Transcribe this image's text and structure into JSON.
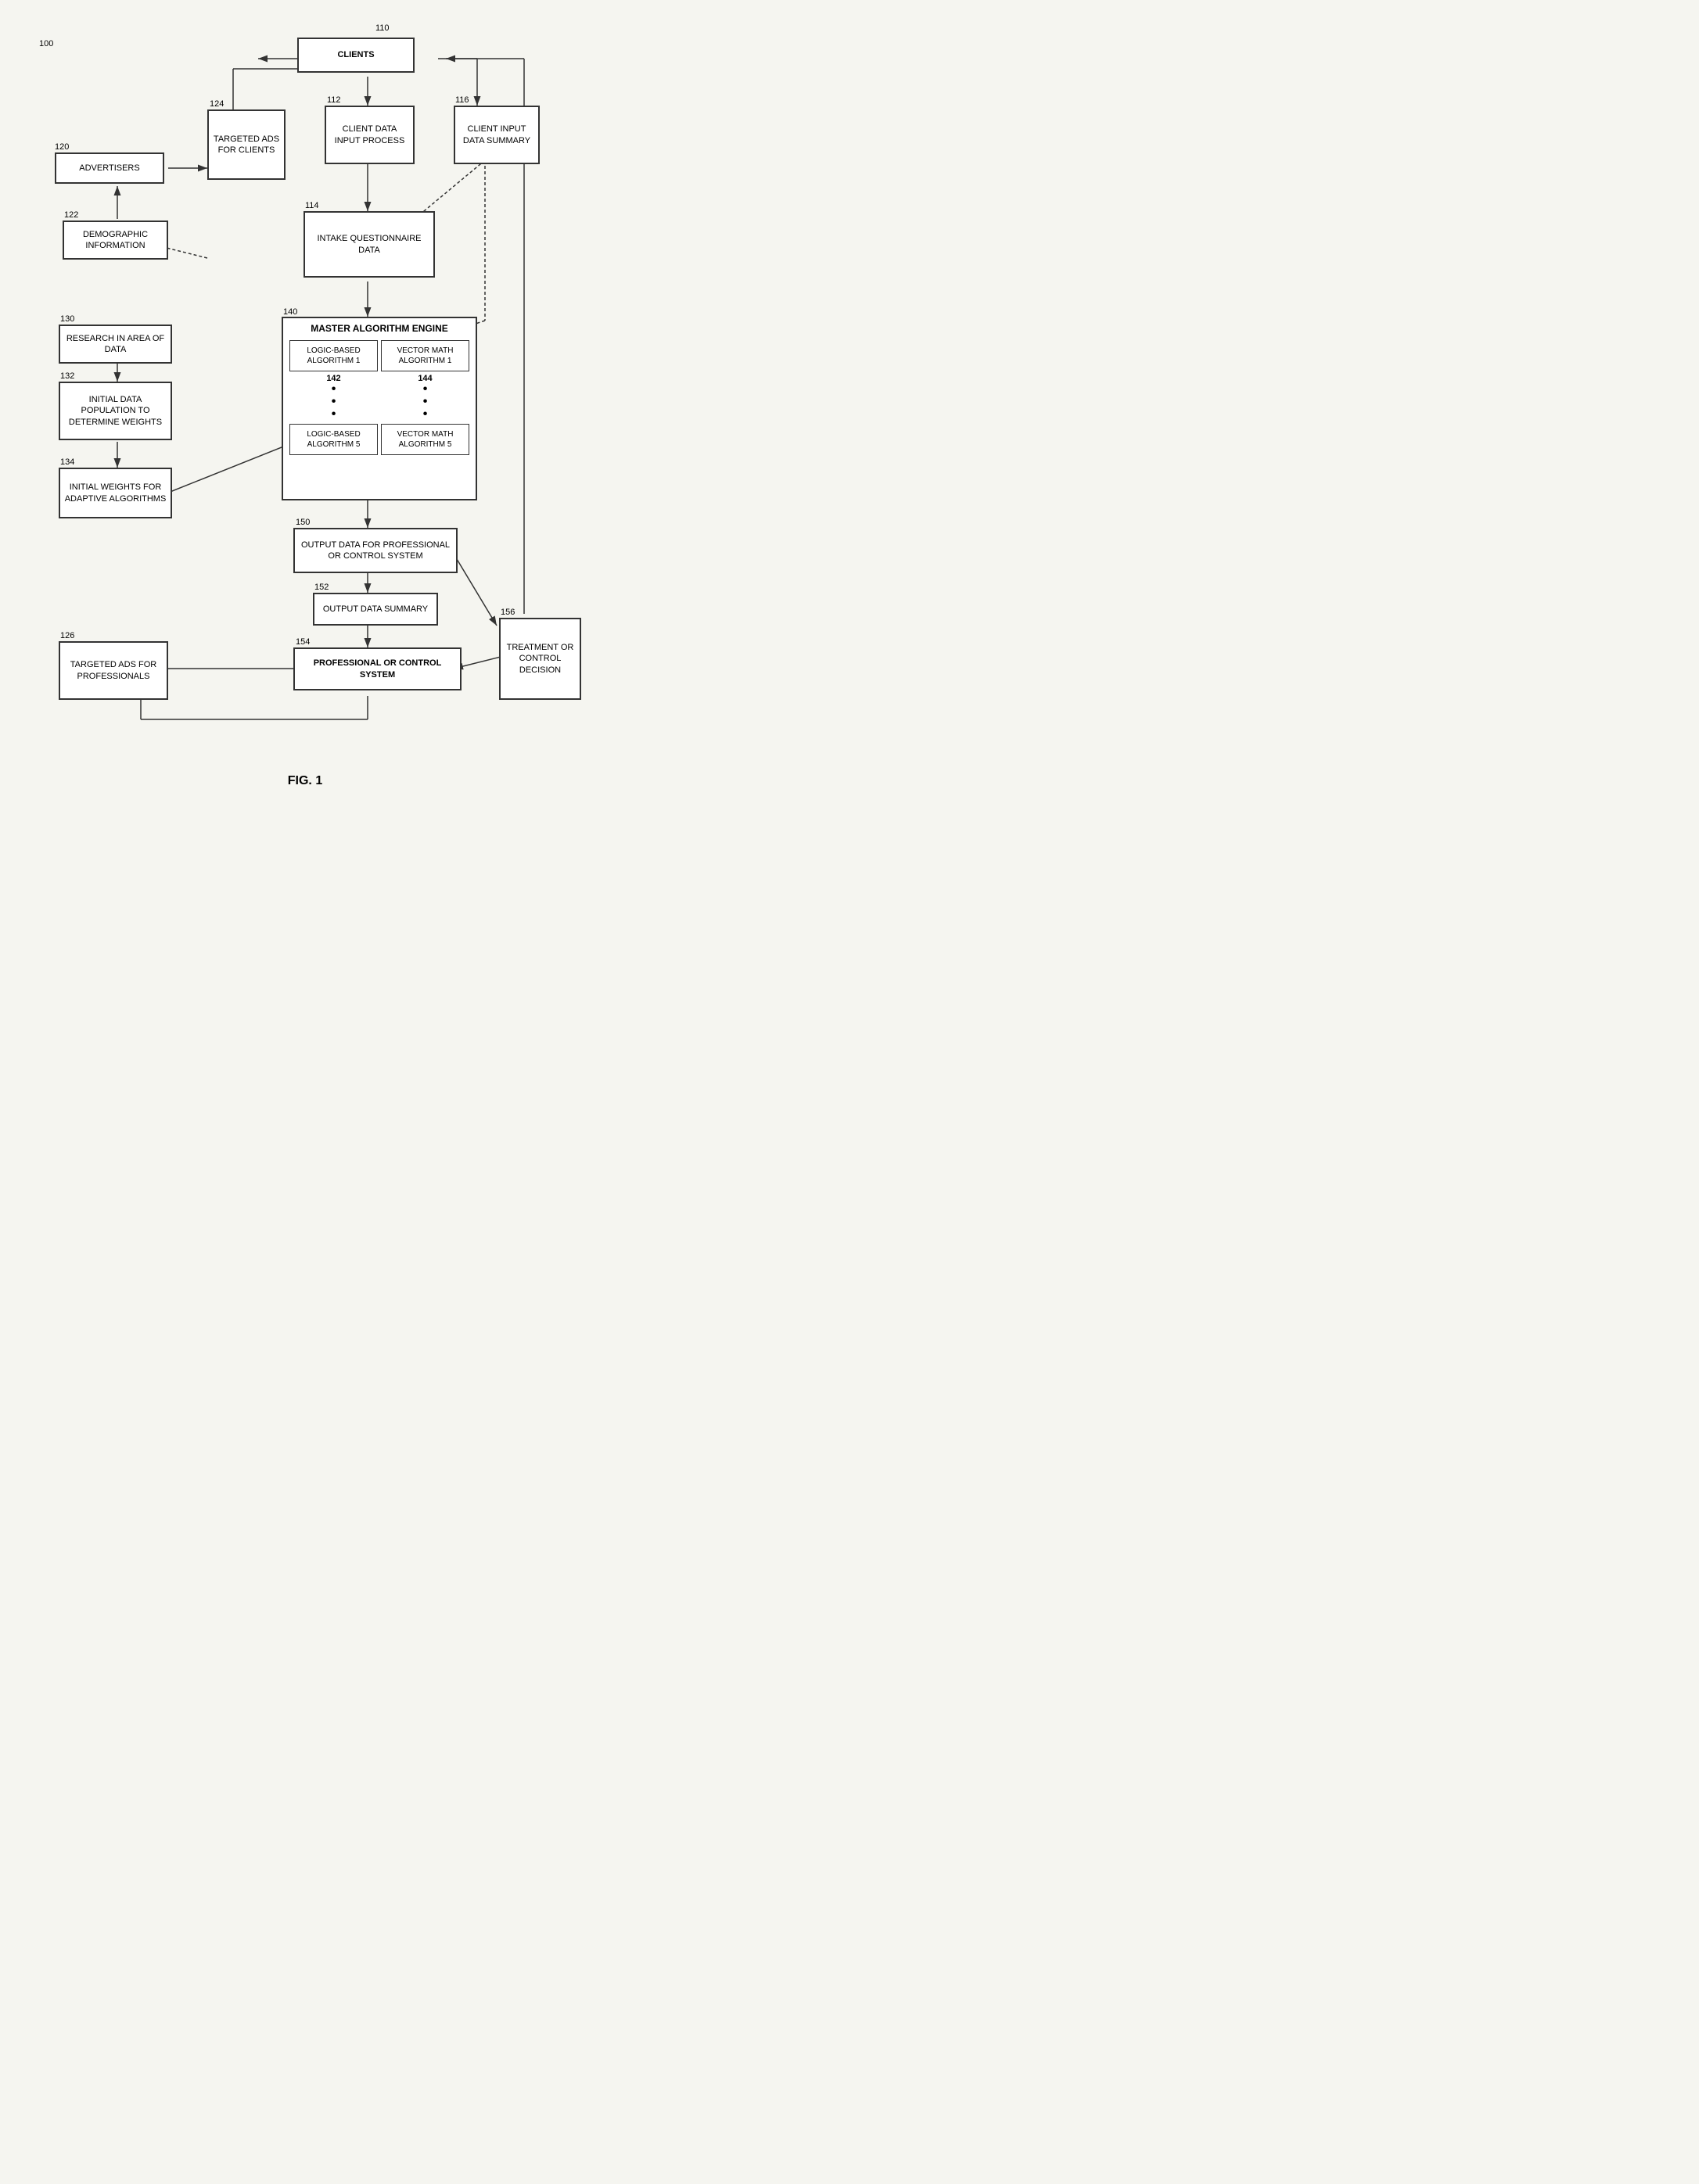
{
  "figure": {
    "label": "FIG. 1",
    "ref_main": "100",
    "boxes": {
      "clients": {
        "label": "CLIENTS",
        "ref": "110",
        "bold": true
      },
      "advertisers": {
        "label": "ADVERTISERS",
        "ref": "120",
        "bold": false
      },
      "targeted_ads_clients": {
        "label": "TARGETED ADS FOR CLIENTS",
        "ref": "124",
        "bold": false
      },
      "client_data_input": {
        "label": "CLIENT DATA INPUT PROCESS",
        "ref": "112",
        "bold": false
      },
      "client_input_data_summary": {
        "label": "CLIENT INPUT DATA SUMMARY",
        "ref": "116",
        "bold": false
      },
      "demographic_info": {
        "label": "DEMOGRAPHIC INFORMATION",
        "ref": "122",
        "bold": false
      },
      "intake_questionnaire": {
        "label": "INTAKE QUESTIONNAIRE DATA",
        "ref": "114",
        "bold": false
      },
      "master_algo_engine": {
        "label": "MASTER ALGORITHM ENGINE",
        "ref": "140",
        "bold": true
      },
      "logic_algo_1": {
        "label": "LOGIC-BASED ALGORITHM 1",
        "ref": "142",
        "bold": false
      },
      "vector_algo_1": {
        "label": "VECTOR MATH ALGORITHM 1",
        "ref": "144",
        "bold": false
      },
      "logic_algo_5": {
        "label": "LOGIC-BASED ALGORITHM 5",
        "ref": "",
        "bold": false
      },
      "vector_algo_5": {
        "label": "VECTOR MATH ALGORITHM 5",
        "ref": "",
        "bold": false
      },
      "research_area": {
        "label": "RESEARCH IN AREA OF DATA",
        "ref": "130",
        "bold": false
      },
      "initial_data_pop": {
        "label": "INITIAL DATA POPULATION TO DETERMINE WEIGHTS",
        "ref": "132",
        "bold": false
      },
      "initial_weights": {
        "label": "INITIAL WEIGHTS FOR ADAPTIVE ALGORITHMS",
        "ref": "134",
        "bold": false
      },
      "output_data": {
        "label": "OUTPUT DATA FOR PROFESSIONAL OR CONTROL SYSTEM",
        "ref": "150",
        "bold": false
      },
      "output_data_summary": {
        "label": "OUTPUT DATA SUMMARY",
        "ref": "152",
        "bold": false
      },
      "professional_control": {
        "label": "PROFESSIONAL OR CONTROL SYSTEM",
        "ref": "154",
        "bold": true
      },
      "treatment_control": {
        "label": "TREATMENT OR CONTROL DECISION",
        "ref": "156",
        "bold": false
      },
      "targeted_ads_prof": {
        "label": "TARGETED ADS FOR PROFESSIONALS",
        "ref": "126",
        "bold": false
      }
    }
  }
}
